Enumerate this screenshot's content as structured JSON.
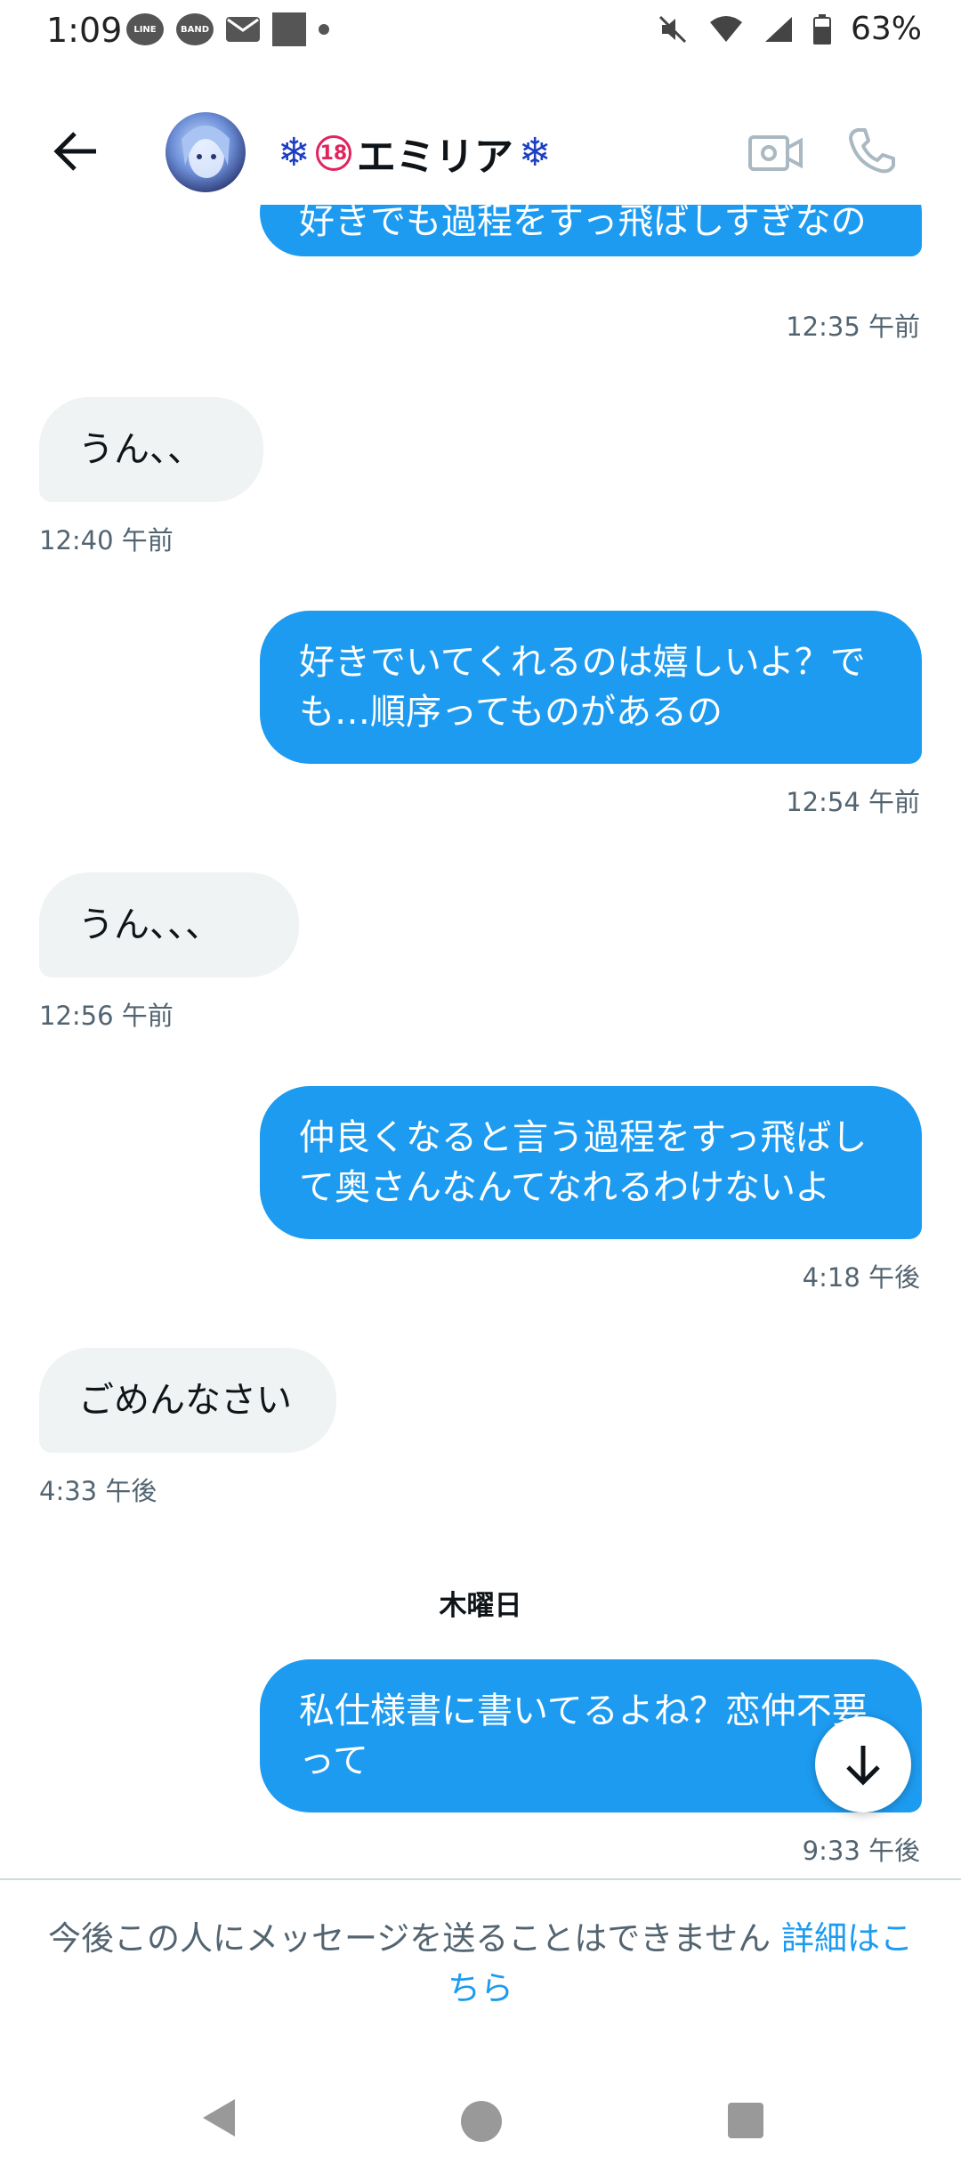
{
  "status_bar": {
    "time": "1:09",
    "line_label": "LINE",
    "band_label": "BAND",
    "battery": "63%"
  },
  "header": {
    "title": "エミリア",
    "badge": "18"
  },
  "messages": [
    {
      "text": "好きでも過程をすっ飛ばしすぎなの",
      "time": "12:35 午前"
    },
    {
      "text": "うん、、",
      "time": "12:40 午前"
    },
    {
      "text": "好きでいてくれるのは嬉しいよ？でも…順序ってものがあるの",
      "time": "12:54 午前"
    },
    {
      "text": "うん、、、",
      "time": "12:56 午前"
    },
    {
      "text": "仲良くなると言う過程をすっ飛ばして奥さんなんてなれるわけないよ",
      "time": "4:18 午後"
    },
    {
      "text": "ごめんなさい",
      "time": "4:33 午後"
    },
    {
      "text": "私仕様書に書いてるよね？恋仲不要って",
      "time": "9:33 午後"
    }
  ],
  "day_separator": "木曜日",
  "notice": {
    "text": "今後この人にメッセージを送ることはできません",
    "link": "詳細はこちら"
  },
  "colors": {
    "sent_bubble": "#1d9bf0",
    "received_bubble": "#eff3f4",
    "link": "#1d9bf0"
  }
}
